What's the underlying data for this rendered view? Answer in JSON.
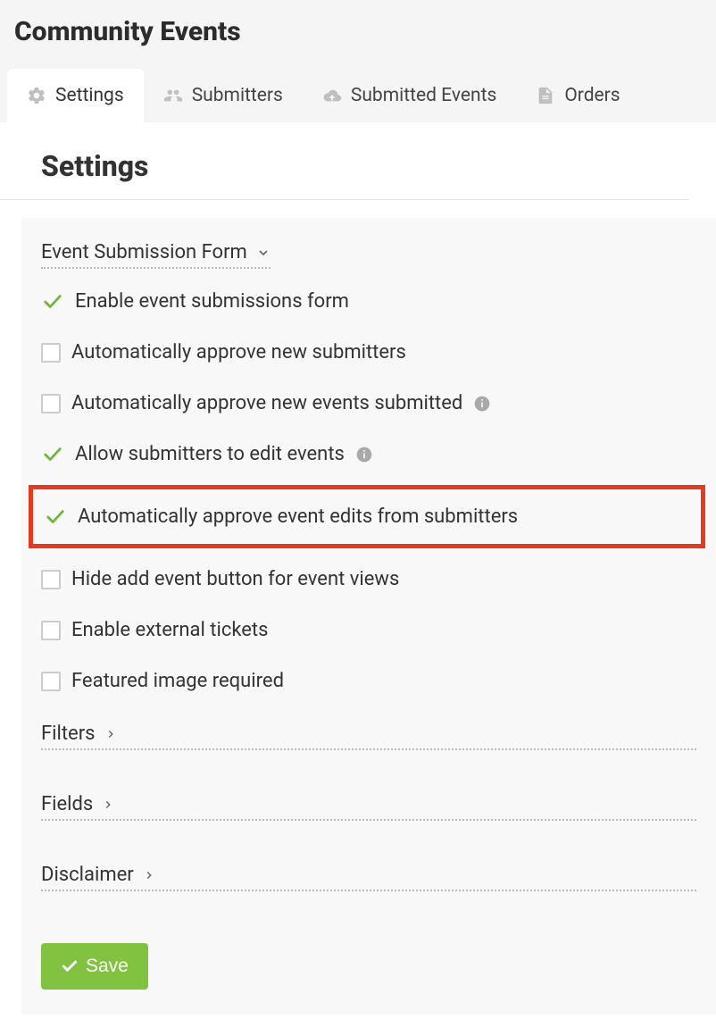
{
  "header": {
    "title": "Community Events"
  },
  "tabs": [
    {
      "label": "Settings",
      "active": true
    },
    {
      "label": "Submitters",
      "active": false
    },
    {
      "label": "Submitted Events",
      "active": false
    },
    {
      "label": "Orders",
      "active": false
    }
  ],
  "section": {
    "title": "Settings"
  },
  "form_section": {
    "label": "Event Submission Form",
    "options": [
      {
        "label": "Enable event submissions form",
        "checked": true,
        "info": false,
        "highlighted": false
      },
      {
        "label": "Automatically approve new submitters",
        "checked": false,
        "info": false,
        "highlighted": false
      },
      {
        "label": "Automatically approve new events submitted",
        "checked": false,
        "info": true,
        "highlighted": false
      },
      {
        "label": "Allow submitters to edit events",
        "checked": true,
        "info": true,
        "highlighted": false
      },
      {
        "label": "Automatically approve event edits from submitters",
        "checked": true,
        "info": false,
        "highlighted": true
      },
      {
        "label": "Hide add event button for event views",
        "checked": false,
        "info": false,
        "highlighted": false
      },
      {
        "label": "Enable external tickets",
        "checked": false,
        "info": false,
        "highlighted": false
      },
      {
        "label": "Featured image required",
        "checked": false,
        "info": false,
        "highlighted": false
      }
    ]
  },
  "collapsed_sections": [
    {
      "label": "Filters"
    },
    {
      "label": "Fields"
    },
    {
      "label": "Disclaimer"
    }
  ],
  "actions": {
    "save_label": "Save"
  },
  "colors": {
    "accent_green": "#81c341",
    "check_green": "#6fb53a",
    "highlight_red": "#e23b1f"
  }
}
